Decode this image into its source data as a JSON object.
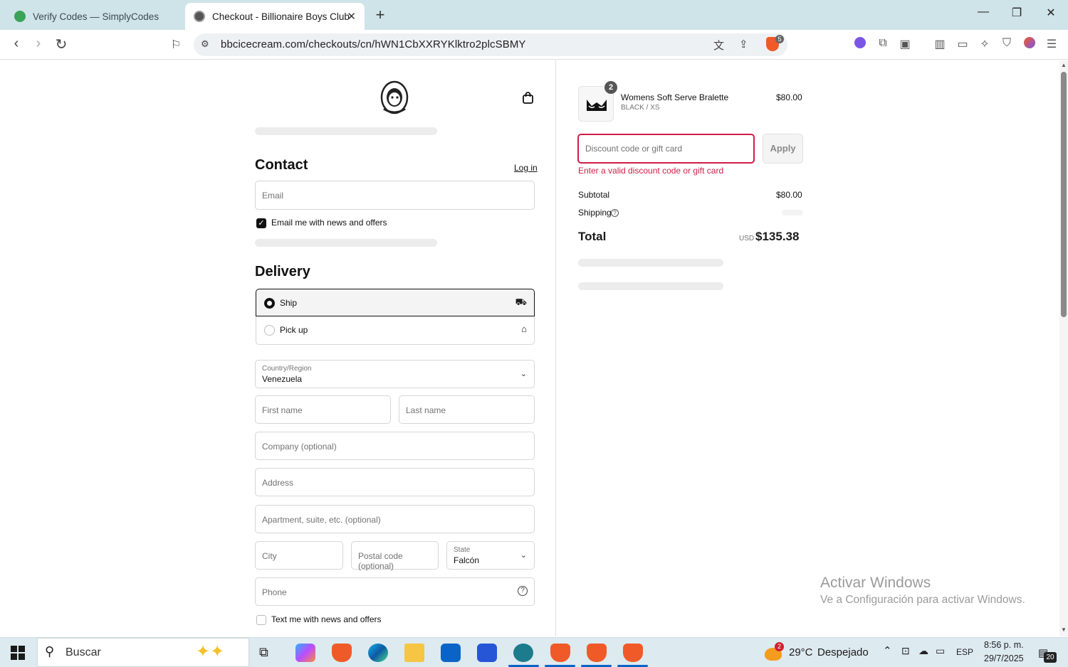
{
  "browser": {
    "tabs": [
      {
        "title": "Verify Codes — SimplyCodes",
        "active": false
      },
      {
        "title": "Checkout - Billionaire Boys Club",
        "active": true
      }
    ],
    "url": "bbcicecream.com/checkouts/cn/hWN1CbXXRYKlktro2plcSBMY",
    "shield_badge": "5"
  },
  "checkout": {
    "contact": {
      "heading": "Contact",
      "login_link": "Log in",
      "email_placeholder": "Email",
      "email_optin_label": "Email me with news and offers",
      "email_optin_checked": true
    },
    "delivery": {
      "heading": "Delivery",
      "options": [
        {
          "label": "Ship",
          "selected": true,
          "icon": "truck-icon"
        },
        {
          "label": "Pick up",
          "selected": false,
          "icon": "store-icon"
        }
      ],
      "country_label": "Country/Region",
      "country_value": "Venezuela",
      "first_name_placeholder": "First name",
      "last_name_placeholder": "Last name",
      "company_placeholder": "Company (optional)",
      "address_placeholder": "Address",
      "apartment_placeholder": "Apartment, suite, etc. (optional)",
      "city_placeholder": "City",
      "postal_placeholder": "Postal code (optional)",
      "state_label": "State",
      "state_value": "Falcón",
      "phone_placeholder": "Phone",
      "sms_optin_label": "Text me with news and offers",
      "sms_optin_checked": false
    }
  },
  "summary": {
    "item": {
      "name": "Womens Soft Serve Bralette",
      "variant": "BLACK / XS",
      "price": "$80.00",
      "quantity": "2"
    },
    "discount_placeholder": "Discount code or gift card",
    "apply_label": "Apply",
    "discount_error": "Enter a valid discount code or gift card",
    "subtotal_label": "Subtotal",
    "subtotal_value": "$80.00",
    "shipping_label": "Shipping",
    "total_label": "Total",
    "currency": "USD",
    "total_value": "$135.38"
  },
  "watermark": {
    "line1": "Activar Windows",
    "line2": "Ve a Configuración para activar Windows."
  },
  "taskbar": {
    "search_label": "Buscar",
    "weather_badge": "2",
    "weather_temp": "29°C",
    "weather_desc": "Despejado",
    "language": "ESP",
    "time": "8:56 p. m.",
    "date": "29/7/2025",
    "notification_count": "20"
  },
  "colors": {
    "accent_error": "#d01d47",
    "tab_strip": "#cfe4e8",
    "taskbar": "#ddeaf0"
  }
}
